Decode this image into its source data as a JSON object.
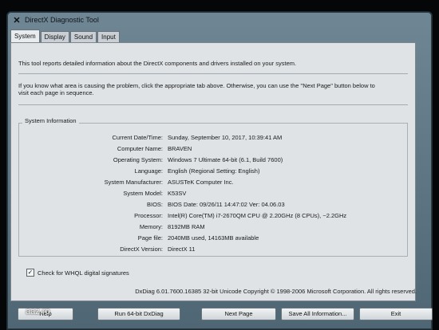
{
  "window": {
    "title": "DirectX Diagnostic Tool"
  },
  "tabs": [
    {
      "label": "System",
      "active": true
    },
    {
      "label": "Display"
    },
    {
      "label": "Sound"
    },
    {
      "label": "Input"
    }
  ],
  "intro": {
    "line1": "This tool reports detailed information about the DirectX components and drivers installed on your system.",
    "line2": "If you know what area is causing the problem, click the appropriate tab above.  Otherwise, you can use the \"Next Page\" button below to",
    "line3": "visit each page in sequence."
  },
  "system_info": {
    "group_label": "System Information",
    "rows": [
      {
        "label": "Current Date/Time:",
        "value": "Sunday, September 10, 2017, 10:39:41 AM"
      },
      {
        "label": "Computer Name:",
        "value": "BRAVEN"
      },
      {
        "label": "Operating System:",
        "value": "Windows 7 Ultimate 64-bit (6.1, Build 7600)"
      },
      {
        "label": "Language:",
        "value": "English (Regional Setting: English)"
      },
      {
        "label": "System Manufacturer:",
        "value": "ASUSTeK Computer Inc."
      },
      {
        "label": "System Model:",
        "value": "K53SV"
      },
      {
        "label": "BIOS:",
        "value": "BIOS Date: 09/26/11 14:47:02 Ver: 04.06.03"
      },
      {
        "label": "Processor:",
        "value": "Intel(R) Core(TM) i7-2670QM CPU @ 2.20GHz (8 CPUs), ~2.2GHz"
      },
      {
        "label": "Memory:",
        "value": "8192MB RAM"
      },
      {
        "label": "Page file:",
        "value": "2040MB used, 14163MB available"
      },
      {
        "label": "DirectX Version:",
        "value": "DirectX 11"
      }
    ]
  },
  "whql": {
    "label": "Check for WHQL digital signatures",
    "checked": true
  },
  "copyright": "DxDiag 6.01.7600.16385 32-bit Unicode  Copyright © 1998-2006 Microsoft Corporation.  All rights reserved.",
  "buttons": {
    "help": "Help",
    "run64": "Run 64-bit DxDiag",
    "next": "Next Page",
    "save": "Save All Information...",
    "exit": "Exit"
  },
  "watermark": "aaz.ro"
}
